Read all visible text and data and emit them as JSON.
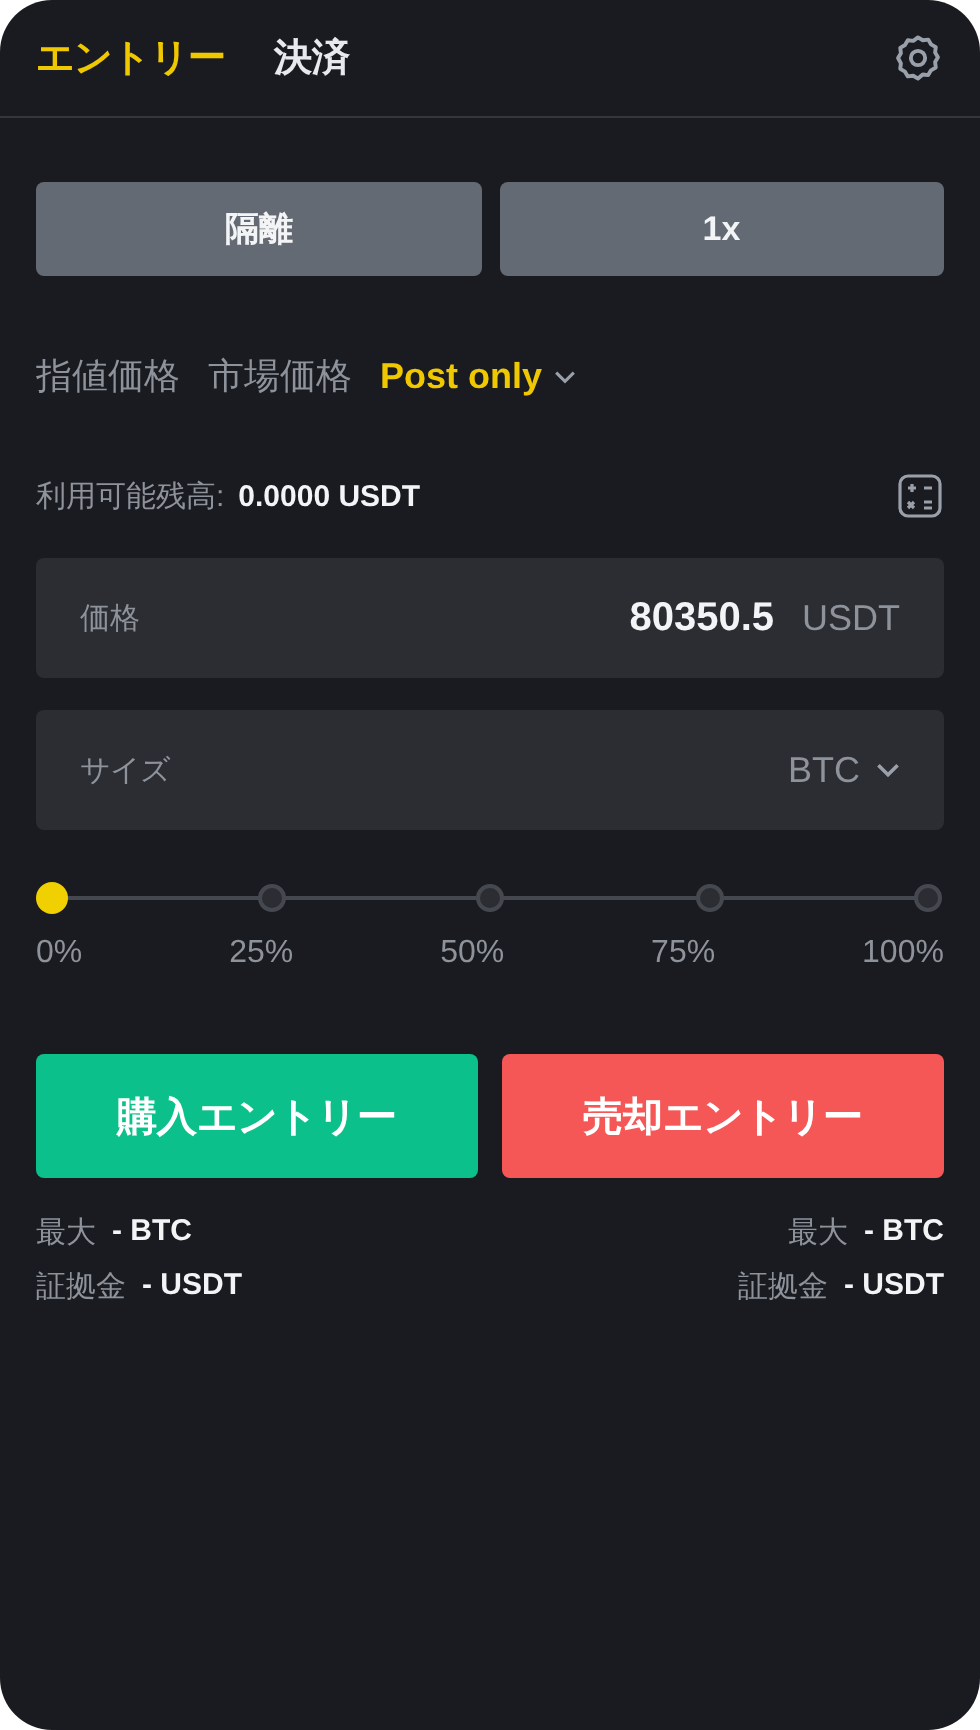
{
  "tabs": [
    {
      "label": "エントリー",
      "selected": true
    },
    {
      "label": "決済",
      "selected": false
    }
  ],
  "margin_buttons": [
    "隔離",
    "1x"
  ],
  "order_types": [
    {
      "label": "指値価格",
      "selected": false
    },
    {
      "label": "市場価格",
      "selected": false
    },
    {
      "label": "Post only",
      "selected": true
    }
  ],
  "balance": {
    "label": "利用可能残高:",
    "value": "0.0000 USDT"
  },
  "price_field": {
    "placeholder": "価格",
    "value": "80350.5",
    "unit": "USDT"
  },
  "size_field": {
    "placeholder": "サイズ",
    "unit": "BTC"
  },
  "slider": {
    "level": 0,
    "marks": [
      "0%",
      "25%",
      "50%",
      "75%",
      "100%"
    ]
  },
  "actions": [
    {
      "label": "購入エントリー",
      "kind": "buy",
      "info": [
        {
          "label": "最大",
          "value": "- BTC"
        },
        {
          "label": "証拠金",
          "value": "- USDT"
        }
      ]
    },
    {
      "label": "売却エントリー",
      "kind": "sell",
      "info": [
        {
          "label": "最大",
          "value": "- BTC"
        },
        {
          "label": "証拠金",
          "value": "- USDT"
        }
      ]
    }
  ]
}
